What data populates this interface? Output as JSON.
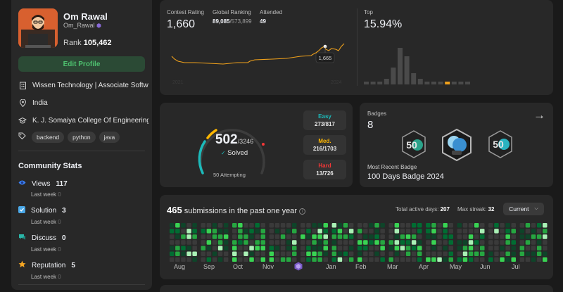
{
  "profile": {
    "name": "Om Rawal",
    "handle": "Om_Rawal",
    "rank_label": "Rank",
    "rank_value": "105,462",
    "edit_label": "Edit Profile",
    "company": "Wissen Technology | Associate Softw...",
    "location": "India",
    "school": "K. J. Somaiya College Of Engineering",
    "skills": [
      "backend",
      "python",
      "java"
    ]
  },
  "community": {
    "title": "Community Stats",
    "views": {
      "label": "Views",
      "value": "117",
      "sub": "Last week",
      "sub_value": "0"
    },
    "solution": {
      "label": "Solution",
      "value": "3",
      "sub": "Last week",
      "sub_value": "0"
    },
    "discuss": {
      "label": "Discuss",
      "value": "0",
      "sub": "Last week",
      "sub_value": "0"
    },
    "reputation": {
      "label": "Reputation",
      "value": "5",
      "sub": "Last week",
      "sub_value": "0"
    }
  },
  "contest": {
    "rating_label": "Contest Rating",
    "rating": "1,660",
    "global_label": "Global Ranking",
    "global_rank": "89,085",
    "global_total": "/573,899",
    "attended_label": "Attended",
    "attended": "49",
    "tooltip": "1,665",
    "axis_left": "2021",
    "axis_right": "2024",
    "top_label": "Top",
    "top_value": "15.94%",
    "histogram": [
      1,
      1,
      1,
      2,
      6,
      13,
      10,
      4,
      2,
      1,
      1,
      1,
      1,
      1,
      1,
      1
    ]
  },
  "solved": {
    "count": "502",
    "total": "/3246",
    "label": "Solved",
    "attempting": "50 Attempting",
    "easy": {
      "label": "Easy",
      "value": "273/817",
      "color": "#1cbaba"
    },
    "medium": {
      "label": "Med.",
      "value": "216/1703",
      "color": "#ffb700"
    },
    "hard": {
      "label": "Hard",
      "value": "13/726",
      "color": "#f63737"
    }
  },
  "badges": {
    "label": "Badges",
    "count": "8",
    "recent_label": "Most Recent Badge",
    "recent_name": "100 Days Badge 2024",
    "badge_texts": [
      "50",
      "50"
    ]
  },
  "submissions": {
    "count": "465",
    "text": "submissions in the past one year",
    "active_label": "Total active days:",
    "active_value": "207",
    "streak_label": "Max streak:",
    "streak_value": "32",
    "current_label": "Current",
    "months": [
      "Aug",
      "Sep",
      "Oct",
      "Nov",
      "Jan",
      "Feb",
      "Mar",
      "Apr",
      "May",
      "Jun",
      "Jul"
    ]
  }
}
